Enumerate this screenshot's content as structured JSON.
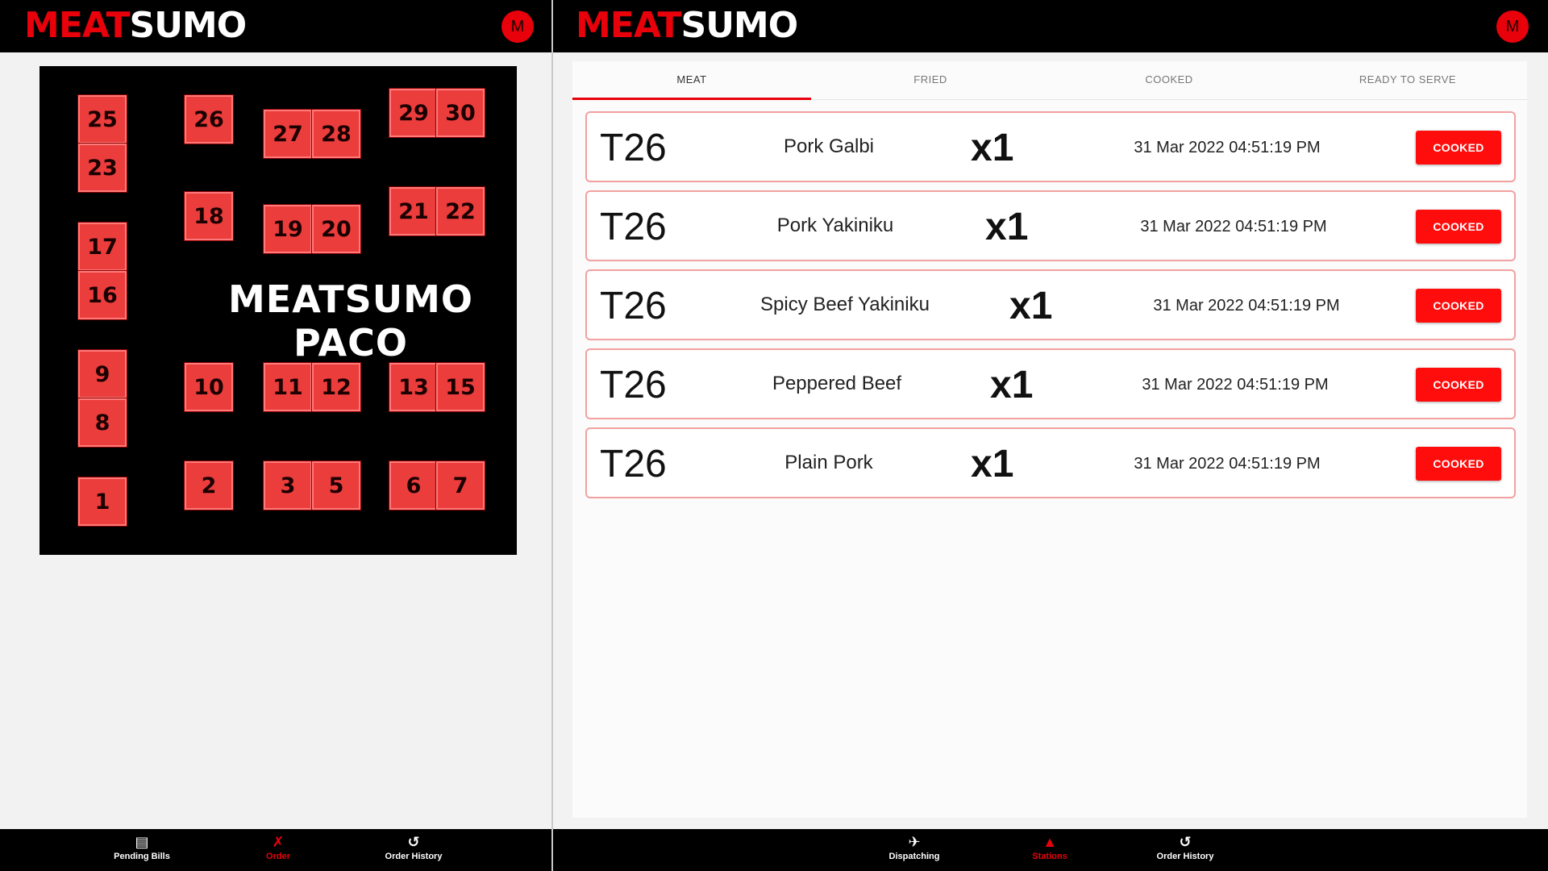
{
  "left_app": {
    "logo": {
      "part1": "MEAT",
      "part2": "SUMO"
    },
    "avatar_letter": "M",
    "floor_plan": {
      "title": "MEATSUMO PACO",
      "tables": [
        "25",
        "23",
        "17",
        "16",
        "9",
        "8",
        "1",
        "26",
        "18",
        "10",
        "2",
        "27",
        "28",
        "19",
        "20",
        "11",
        "12",
        "3",
        "5",
        "29",
        "30",
        "21",
        "22",
        "13",
        "15",
        "6",
        "7"
      ]
    },
    "nav": [
      {
        "label": "Pending Bills",
        "icon": "receipt-icon"
      },
      {
        "label": "Order",
        "icon": "utensils-icon"
      },
      {
        "label": "Order History",
        "icon": "history-icon"
      }
    ]
  },
  "right_app": {
    "logo": {
      "part1": "MEAT",
      "part2": "SUMO"
    },
    "avatar_letter": "M",
    "tabs": [
      "MEAT",
      "FRIED",
      "COOKED",
      "READY TO SERVE"
    ],
    "orders": [
      {
        "table": "T26",
        "item": "Pork Galbi",
        "qty": "x1",
        "time": "31 Mar 2022 04:51:19 PM",
        "action": "COOKED"
      },
      {
        "table": "T26",
        "item": "Pork Yakiniku",
        "qty": "x1",
        "time": "31 Mar 2022 04:51:19 PM",
        "action": "COOKED"
      },
      {
        "table": "T26",
        "item": "Spicy Beef Yakiniku",
        "qty": "x1",
        "time": "31 Mar 2022 04:51:19 PM",
        "action": "COOKED"
      },
      {
        "table": "T26",
        "item": "Peppered Beef",
        "qty": "x1",
        "time": "31 Mar 2022 04:51:19 PM",
        "action": "COOKED"
      },
      {
        "table": "T26",
        "item": "Plain Pork",
        "qty": "x1",
        "time": "31 Mar 2022 04:51:19 PM",
        "action": "COOKED"
      }
    ],
    "nav": [
      {
        "label": "Dispatching",
        "icon": "scooter-icon"
      },
      {
        "label": "Stations",
        "icon": "cloche-icon"
      },
      {
        "label": "Order History",
        "icon": "history-icon"
      }
    ]
  },
  "colors": {
    "brand_red": "#e8000b",
    "topbar": "#000000",
    "table_fill": "#ec3d3d"
  }
}
